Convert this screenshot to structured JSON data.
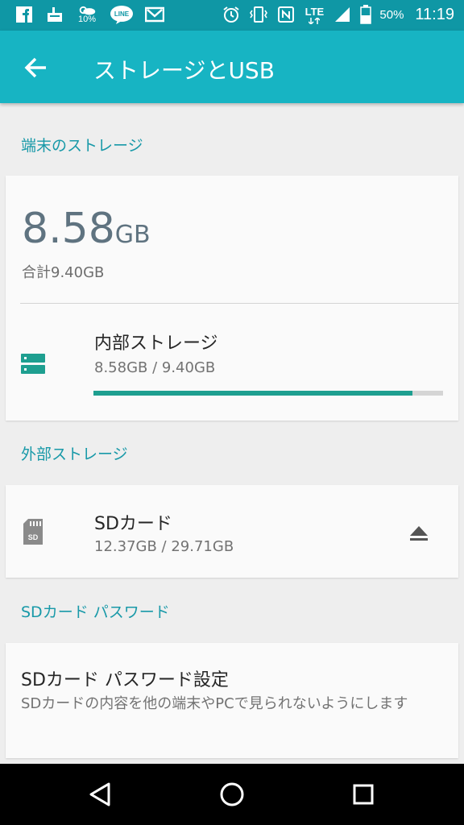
{
  "status_bar": {
    "icons_left": [
      "facebook-icon",
      "cleaner-icon",
      "weather-icon",
      "line-icon",
      "mail-icon"
    ],
    "weather_percent": "10%",
    "line_label": "LINE",
    "icons_right": [
      "alarm-icon",
      "vibrate-icon",
      "nfc-icon",
      "lte-icon",
      "signal-icon",
      "battery-icon"
    ],
    "network": "LTE",
    "battery": "50%",
    "time": "11:19"
  },
  "app_bar": {
    "title": "ストレージとUSB",
    "back_icon": "arrow-back-icon"
  },
  "device_storage": {
    "header": "端末のストレージ",
    "used_value": "8.58",
    "used_unit": "GB",
    "total": "合計9.40GB",
    "internal": {
      "icon": "storage-icon",
      "title": "内部ストレージ",
      "usage": "8.58GB / 9.40GB",
      "fraction": 0.913
    }
  },
  "external_storage": {
    "header": "外部ストレージ",
    "sd": {
      "icon": "sd-card-icon",
      "icon_label": "SD",
      "title": "SDカード",
      "usage": "12.37GB / 29.71GB",
      "eject_icon": "eject-icon"
    }
  },
  "sd_password": {
    "header": "SDカード パスワード",
    "title": "SDカード パスワード設定",
    "description": "SDカードの内容を他の端末やPCで見られないようにします"
  },
  "navigation": {
    "back": "nav-back-icon",
    "home": "nav-home-icon",
    "recents": "nav-recents-icon"
  },
  "colors": {
    "status_bar": "#0f97a5",
    "app_bar": "#17b4c3",
    "accent": "#1899a8",
    "progress": "#1e9f90"
  }
}
